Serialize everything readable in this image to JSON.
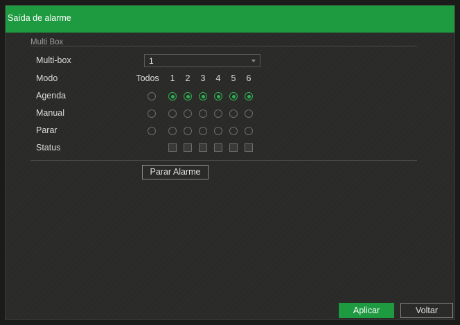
{
  "window": {
    "title": "Saída de alarme"
  },
  "group": {
    "legend": "Multi Box"
  },
  "rows": {
    "multibox_label": "Multi-box",
    "modo_label": "Modo",
    "agenda_label": "Agenda",
    "manual_label": "Manual",
    "parar_label": "Parar",
    "status_label": "Status"
  },
  "multibox_select": {
    "value": "1"
  },
  "mode_columns": [
    "Todos",
    "1",
    "2",
    "3",
    "4",
    "5",
    "6"
  ],
  "radio_state": {
    "agenda": [
      false,
      true,
      true,
      true,
      true,
      true,
      true
    ],
    "manual": [
      false,
      false,
      false,
      false,
      false,
      false,
      false
    ],
    "parar": [
      false,
      false,
      false,
      false,
      false,
      false,
      false
    ]
  },
  "status_boxes": 6,
  "buttons": {
    "stop_alarm": "Parar Alarme",
    "apply": "Aplicar",
    "back": "Voltar"
  },
  "colors": {
    "accent": "#1e9a41",
    "radio_checked": "#2fb352",
    "background": "#2a2b28"
  }
}
